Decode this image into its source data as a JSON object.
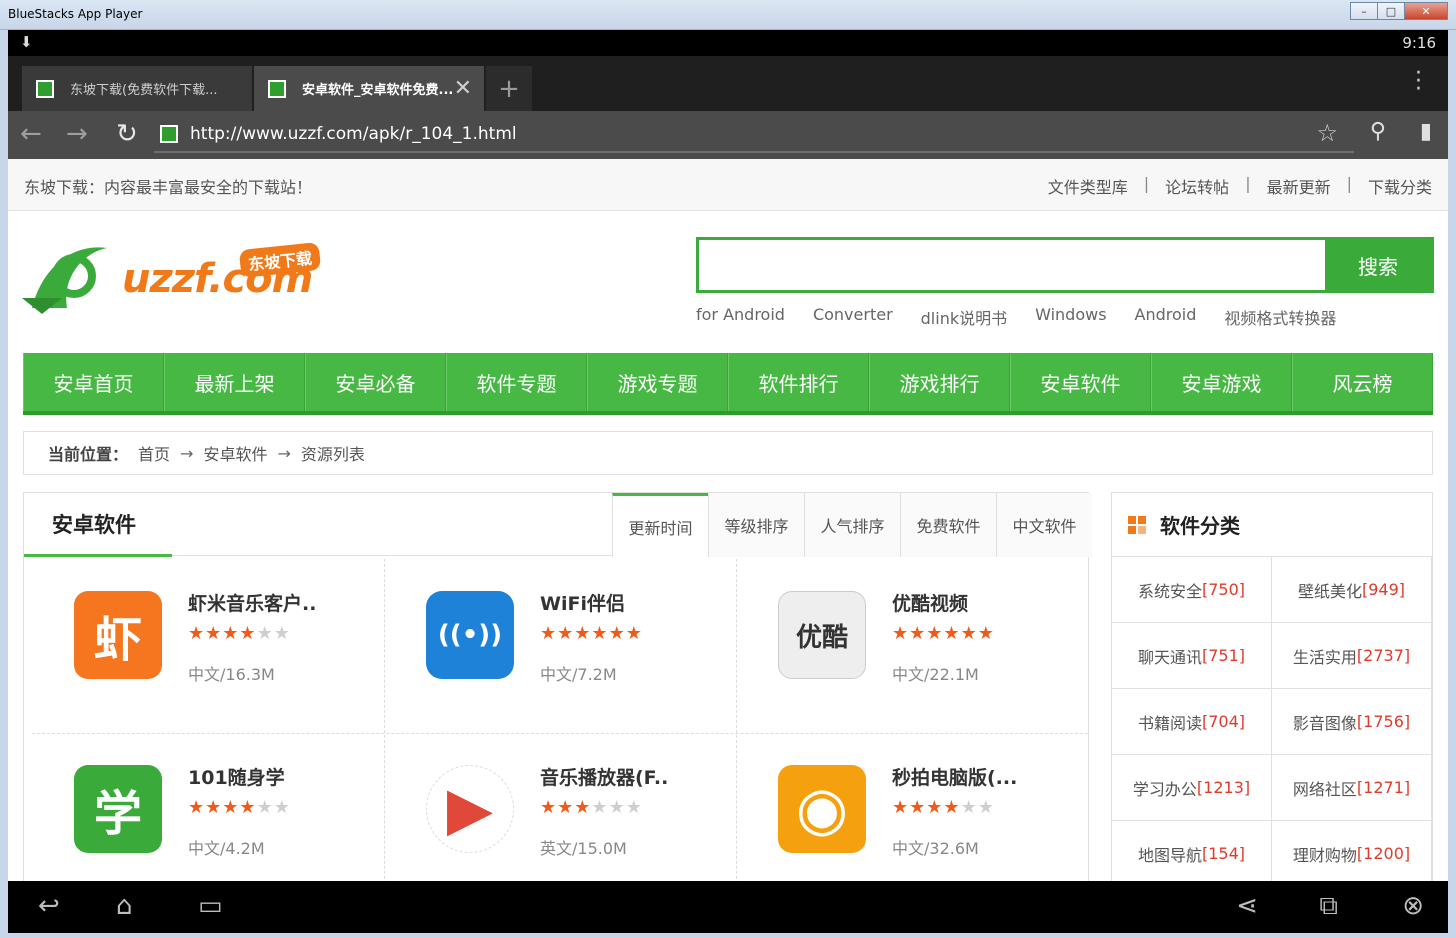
{
  "window": {
    "title": "BlueStacks App Player",
    "minimize": "–",
    "maximize": "□",
    "close": "✕"
  },
  "status": {
    "time": "9:16",
    "download_icon": "⬇"
  },
  "tabs": [
    {
      "title": "东坡下载(免费软件下载..."
    },
    {
      "title": "安卓软件_安卓软件免费..."
    }
  ],
  "tab_close": "✕",
  "tab_new": "+",
  "toolbar": {
    "url": "http://www.uzzf.com/apk/r_104_1.html"
  },
  "topline": {
    "slogan": "东坡下载：内容最丰富最安全的下载站！",
    "links": [
      "文件类型库",
      "论坛转帖",
      "最新更新",
      "下载分类"
    ],
    "separator": "|"
  },
  "logo": {
    "text": "uzzf.com",
    "badge": "东坡下载"
  },
  "search": {
    "button": "搜索",
    "value": ""
  },
  "hotwords": [
    "for Android",
    "Converter",
    "dlink说明书",
    "Windows",
    "Android",
    "视频格式转换器"
  ],
  "nav": [
    "安卓首页",
    "最新上架",
    "安卓必备",
    "软件专题",
    "游戏专题",
    "软件排行",
    "游戏排行",
    "安卓软件",
    "安卓游戏",
    "风云榜"
  ],
  "breadcrumb": {
    "label": "当前位置：",
    "items": [
      "首页",
      "安卓软件",
      "资源列表"
    ],
    "arrow": "→"
  },
  "main": {
    "title": "安卓软件",
    "sort_tabs": [
      "更新时间",
      "等级排序",
      "人气排序",
      "免费软件",
      "中文软件"
    ],
    "apps": [
      {
        "name": "虾米音乐客户..",
        "rating": 4,
        "meta": "中文/16.3M",
        "icon_char": "虾",
        "icon_color": "#f5761e"
      },
      {
        "name": "WiFi伴侣",
        "rating": 6,
        "meta": "中文/7.2M",
        "icon_char": "((•))",
        "icon_color": "#1e82d8"
      },
      {
        "name": "优酷视频",
        "rating": 6,
        "meta": "中文/22.1M",
        "icon_char": "优酷",
        "icon_color": "#eeeeee"
      },
      {
        "name": "101随身学",
        "rating": 4,
        "meta": "中文/4.2M",
        "icon_char": "学",
        "icon_color": "#3aaa3a"
      },
      {
        "name": "音乐播放器(F..",
        "rating": 3,
        "meta": "英文/15.0M",
        "icon_char": "▶",
        "icon_color": "#ffffff"
      },
      {
        "name": "秒拍电脑版(...",
        "rating": 4,
        "meta": "中文/32.6M",
        "icon_char": "◉",
        "icon_color": "#f5a00e"
      }
    ]
  },
  "sidebar": {
    "title": "软件分类",
    "categories": [
      {
        "name": "系统安全",
        "count": "[750]"
      },
      {
        "name": "壁纸美化",
        "count": "[949]"
      },
      {
        "name": "聊天通讯",
        "count": "[751]"
      },
      {
        "name": "生活实用",
        "count": "[2737]"
      },
      {
        "name": "书籍阅读",
        "count": "[704]"
      },
      {
        "name": "影音图像",
        "count": "[1756]"
      },
      {
        "name": "学习办公",
        "count": "[1213]"
      },
      {
        "name": "网络社区",
        "count": "[1271]"
      },
      {
        "name": "地图导航",
        "count": "[154]"
      },
      {
        "name": "理财购物",
        "count": "[1200]"
      }
    ]
  },
  "colors": {
    "brand_green": "#47b843",
    "accent_orange": "#f07a1a",
    "count_red": "#e03a2a"
  }
}
